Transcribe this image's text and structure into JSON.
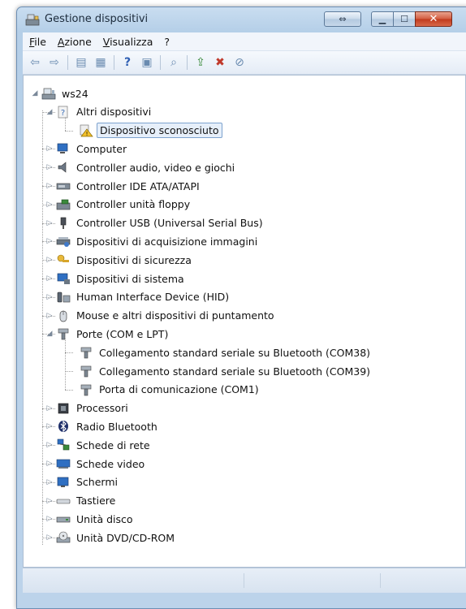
{
  "window": {
    "title": "Gestione dispositivi"
  },
  "menu": [
    "File",
    "Azione",
    "Visualizza",
    "?"
  ],
  "toolbar": [
    "back-arrow-icon",
    "forward-arrow-icon",
    "properties-icon",
    "view-icon",
    "help-icon",
    "console-icon",
    "scan-hardware-icon",
    "update-driver-icon",
    "disable-device-icon",
    "uninstall-device-icon"
  ],
  "tree": [
    {
      "label": "ws24",
      "level": 0,
      "expander": "expanded",
      "icon": "computer-root-icon"
    },
    {
      "label": "Altri dispositivi",
      "level": 1,
      "expander": "expanded",
      "icon": "unknown-category-icon"
    },
    {
      "label": "Dispositivo sconosciuto",
      "level": 2,
      "expander": "none",
      "icon": "warning-device-icon",
      "selected": true
    },
    {
      "label": "Computer",
      "level": 1,
      "expander": "collapsed",
      "icon": "computer-icon"
    },
    {
      "label": "Controller audio, video e giochi",
      "level": 1,
      "expander": "collapsed",
      "icon": "speaker-icon"
    },
    {
      "label": "Controller IDE ATA/ATAPI",
      "level": 1,
      "expander": "collapsed",
      "icon": "ide-controller-icon"
    },
    {
      "label": "Controller unità floppy",
      "level": 1,
      "expander": "collapsed",
      "icon": "floppy-controller-icon"
    },
    {
      "label": "Controller USB (Universal Serial Bus)",
      "level": 1,
      "expander": "collapsed",
      "icon": "usb-icon"
    },
    {
      "label": "Dispositivi di acquisizione immagini",
      "level": 1,
      "expander": "collapsed",
      "icon": "scanner-icon"
    },
    {
      "label": "Dispositivi di sicurezza",
      "level": 1,
      "expander": "collapsed",
      "icon": "security-key-icon"
    },
    {
      "label": "Dispositivi di sistema",
      "level": 1,
      "expander": "collapsed",
      "icon": "system-device-icon"
    },
    {
      "label": "Human Interface Device (HID)",
      "level": 1,
      "expander": "collapsed",
      "icon": "hid-icon"
    },
    {
      "label": "Mouse e altri dispositivi di puntamento",
      "level": 1,
      "expander": "collapsed",
      "icon": "mouse-icon"
    },
    {
      "label": "Porte (COM e LPT)",
      "level": 1,
      "expander": "expanded",
      "icon": "port-icon"
    },
    {
      "label": "Collegamento standard seriale su Bluetooth (COM38)",
      "level": 2,
      "expander": "none",
      "icon": "port-icon"
    },
    {
      "label": "Collegamento standard seriale su Bluetooth (COM39)",
      "level": 2,
      "expander": "none",
      "icon": "port-icon"
    },
    {
      "label": "Porta di comunicazione (COM1)",
      "level": 2,
      "expander": "none",
      "icon": "port-icon"
    },
    {
      "label": "Processori",
      "level": 1,
      "expander": "collapsed",
      "icon": "processor-icon"
    },
    {
      "label": "Radio Bluetooth",
      "level": 1,
      "expander": "collapsed",
      "icon": "bluetooth-icon"
    },
    {
      "label": "Schede di rete",
      "level": 1,
      "expander": "collapsed",
      "icon": "network-adapter-icon"
    },
    {
      "label": "Schede video",
      "level": 1,
      "expander": "collapsed",
      "icon": "display-adapter-icon"
    },
    {
      "label": "Schermi",
      "level": 1,
      "expander": "collapsed",
      "icon": "monitor-icon"
    },
    {
      "label": "Tastiere",
      "level": 1,
      "expander": "collapsed",
      "icon": "keyboard-icon"
    },
    {
      "label": "Unità disco",
      "level": 1,
      "expander": "collapsed",
      "icon": "disk-drive-icon"
    },
    {
      "label": "Unità DVD/CD-ROM",
      "level": 1,
      "expander": "collapsed",
      "icon": "dvd-drive-icon"
    }
  ]
}
